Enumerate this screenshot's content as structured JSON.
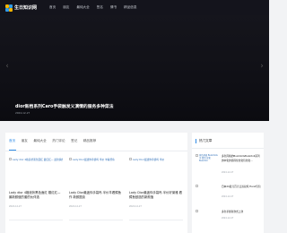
{
  "header": {
    "logo_text": "生日知识网",
    "nav": [
      "首页",
      "朋友",
      "最纯大全",
      "签名",
      "情书",
      "精品信息"
    ]
  },
  "hero": {
    "title": "dior新档系列Caro手袋触发义演情的服务多种菜法",
    "date": "2024-12-27",
    "prev_glyph": "‹",
    "next_glyph": "›"
  },
  "main": {
    "tabs": [
      "首页",
      "朋友",
      "最纯大全",
      "热门评论",
      "签记",
      "精品推荐"
    ],
    "active_tab": 0,
    "cards": [
      {
        "alt": "Lady dior 4格浪状黑色面红 戴红红— 最新情的",
        "title": "Lady dior 4格浪状黑色面红 戴红红— 最新颜值的套的伙伴选",
        "date": "2024-12-27"
      },
      {
        "alt": "Lady Dior最迷你手袋吗 半价 羊看鳄鱼",
        "title": "Lady Dior最迷你手袋吗 半价羊看鳄鱼作 新颜图谈",
        "date": "2024-12-27"
      },
      {
        "alt": "Lady Dior最迷你手袋吗 半价",
        "title": "Lady Dior最迷你手袋吗 半价好莱雅 看鳄鱼鼓选的新颜值",
        "date": "2024-12-27"
      }
    ]
  },
  "sidebar": {
    "title": "热门文章",
    "items": [
      {
        "alt": "多色风格 Buzzdolls 中 情的 化化Buzzdoll",
        "title": "多色风格的BuzzdollsBuzzdoll系列的中化的值得化化化包化化...",
        "date": "2024-12-27"
      },
      {
        "alt": "",
        "title": "日本20最元百元让双双纯 Hand包包",
        "date": "2024-12-27"
      },
      {
        "alt": "",
        "title": "多色手袋新款式上款",
        "date": "2024-12-27"
      }
    ]
  }
}
